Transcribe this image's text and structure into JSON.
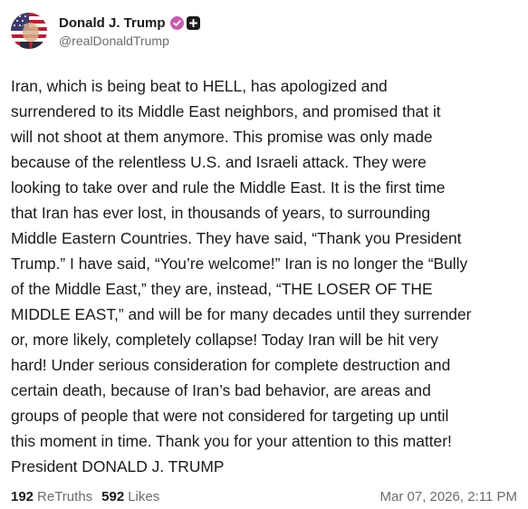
{
  "author": {
    "display_name": "Donald J. Trump",
    "handle": "@realDonaldTrump",
    "avatar_icon": "profile-photo-flag-avatar",
    "verified_icon": "verified-check-badge-icon",
    "plus_icon": "plus-badge-icon",
    "verified_color": "#c75eaf"
  },
  "post": {
    "text": "Iran, which is being beat to HELL, has apologized and\nsurrendered to its Middle East neighbors, and promised that it\nwill not shoot at them anymore. This promise was only made\nbecause of the relentless U.S. and Israeli attack. They were\nlooking to take over and rule the Middle East. It is the first time\nthat Iran has ever lost, in thousands of years, to surrounding\nMiddle Eastern Countries. They have said, “Thank you President\nTrump.” I have said, “You’re welcome!” Iran is no longer the “Bully\nof the Middle East,” they are, instead, “THE LOSER OF THE\nMIDDLE EAST,” and will be for many decades until they surrender\nor, more likely, completely collapse! Today Iran will be hit very\nhard! Under serious consideration for complete destruction and\ncertain death, because of Iran’s bad behavior, are areas and\ngroups of people that were not considered for targeting up until\nthis moment in time. Thank you for your attention to this matter!\nPresident DONALD J. TRUMP"
  },
  "stats": {
    "retruths_count": "192",
    "retruths_label": "ReTruths",
    "likes_count": "592",
    "likes_label": "Likes"
  },
  "timestamp": "Mar 07, 2026, 2:11 PM"
}
